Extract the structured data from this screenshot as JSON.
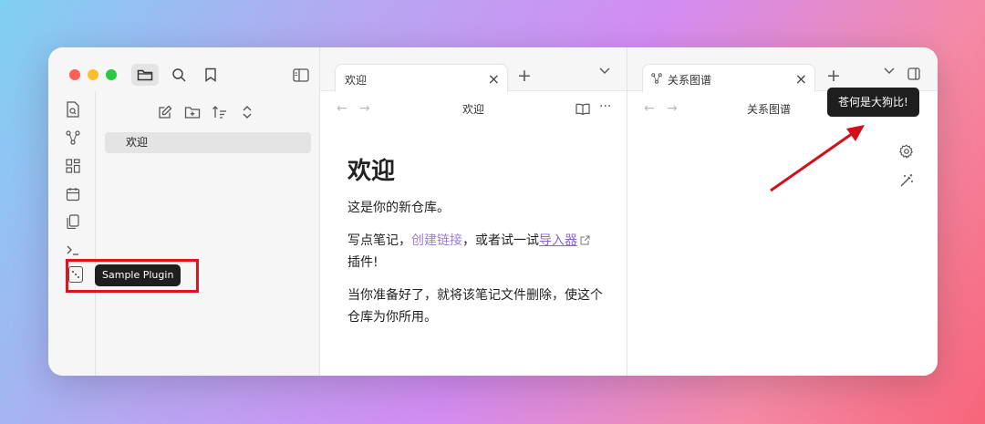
{
  "sidebar": {
    "files": [
      {
        "label": "欢迎"
      }
    ]
  },
  "pane1": {
    "tab": {
      "label": "欢迎"
    },
    "nav_title": "欢迎",
    "content": {
      "heading": "欢迎",
      "p1": "这是你的新仓库。",
      "p2_a": "写点笔记，",
      "p2_link1": "创建链接",
      "p2_b": "，或者试一试",
      "p2_link2": "导入器",
      "p2_c": "插件!",
      "p3": "当你准备好了，就将该笔记文件删除，使这个仓库为你所用。"
    }
  },
  "pane2": {
    "tab": {
      "label": "关系图谱"
    },
    "nav_title": "关系图谱"
  },
  "tooltips": {
    "plugin": "Sample Plugin",
    "notice": "苍何是大狗比!"
  },
  "colors": {
    "accent": "#8c63df",
    "highlight": "#e0141d"
  }
}
